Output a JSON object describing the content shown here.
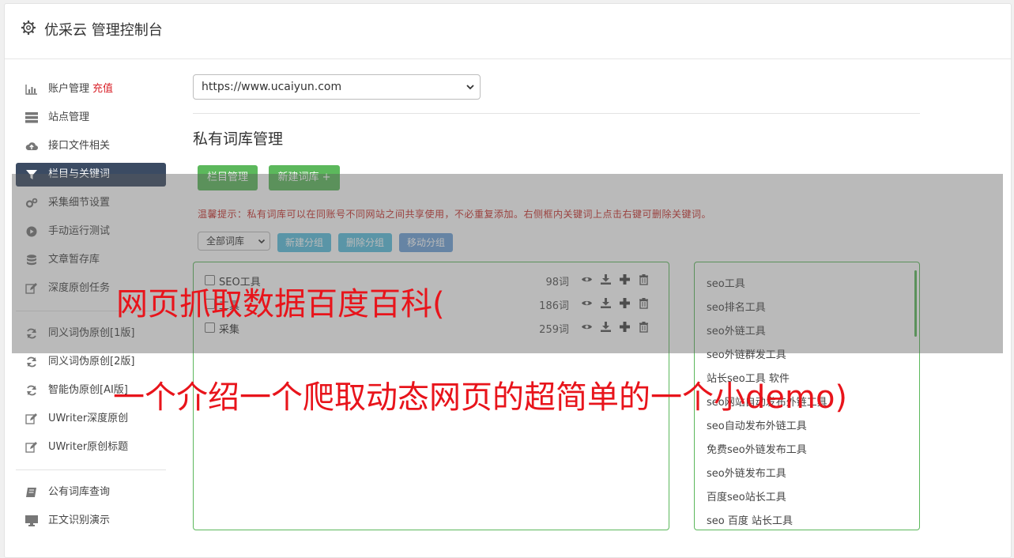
{
  "header": {
    "title": "优采云 管理控制台",
    "icon": "gear-icon"
  },
  "sidebar": {
    "items": [
      {
        "label": "账户管理",
        "badge": "充值",
        "icon": "bar-chart-icon"
      },
      {
        "label": "站点管理",
        "icon": "server-icon"
      },
      {
        "label": "接口文件相关",
        "icon": "cloud-upload-icon"
      },
      {
        "label": "栏目与关键词",
        "icon": "filter-icon",
        "active": true
      },
      {
        "label": "采集细节设置",
        "icon": "gears-icon"
      },
      {
        "label": "手动运行测试",
        "icon": "play-circle-icon"
      },
      {
        "label": "文章暂存库",
        "icon": "database-icon"
      },
      {
        "label": "深度原创任务",
        "icon": "edit-icon"
      },
      {
        "label": "同义词伪原创[1版]",
        "icon": "refresh-icon"
      },
      {
        "label": "同义词伪原创[2版]",
        "icon": "refresh-icon"
      },
      {
        "label": "智能伪原创[AI版]",
        "icon": "refresh-icon"
      },
      {
        "label": "UWriter深度原创",
        "icon": "edit-icon"
      },
      {
        "label": "UWriter原创标题",
        "icon": "edit-icon"
      },
      {
        "label": "公有词库查询",
        "icon": "book-icon"
      },
      {
        "label": "正文识别演示",
        "icon": "monitor-icon"
      }
    ]
  },
  "main": {
    "site_select": "https://www.ucaiyun.com",
    "section_title": "私有词库管理",
    "buttons": {
      "column_manage": "栏目管理",
      "new_library": "新建词库 +"
    },
    "tip": "温馨提示：私有词库可以在同账号不同网站之间共享使用，不必重复添加。右侧框内关键词上点击右键可删除关键词。",
    "group_select": "全部词库",
    "group_buttons": [
      "新建分组",
      "删除分组",
      "移动分组"
    ],
    "libraries": [
      {
        "name": "SEO工具",
        "count": "98词"
      },
      {
        "name": "工具",
        "count": "186词"
      },
      {
        "name": "采集",
        "count": "259词"
      }
    ],
    "keywords": [
      "seo工具",
      "seo排名工具",
      "seo外链工具",
      "seo外链群发工具",
      "站长seo工具 软件",
      "seo网站自动发布外链工具",
      "seo自动发布外链工具",
      "免费seo外链发布工具",
      "seo外链发布工具",
      "百度seo站长工具",
      "seo 百度 站长工具"
    ]
  },
  "overlay": {
    "headline1": "网页抓取数据百度百科(",
    "headline2": "一个介绍一个爬取动态网页的超简单的一个小demo)"
  },
  "colors": {
    "green": "#5cb85c",
    "active_nav": "#3b4b63",
    "headline": "#e8141b",
    "tip": "#c9302c"
  }
}
